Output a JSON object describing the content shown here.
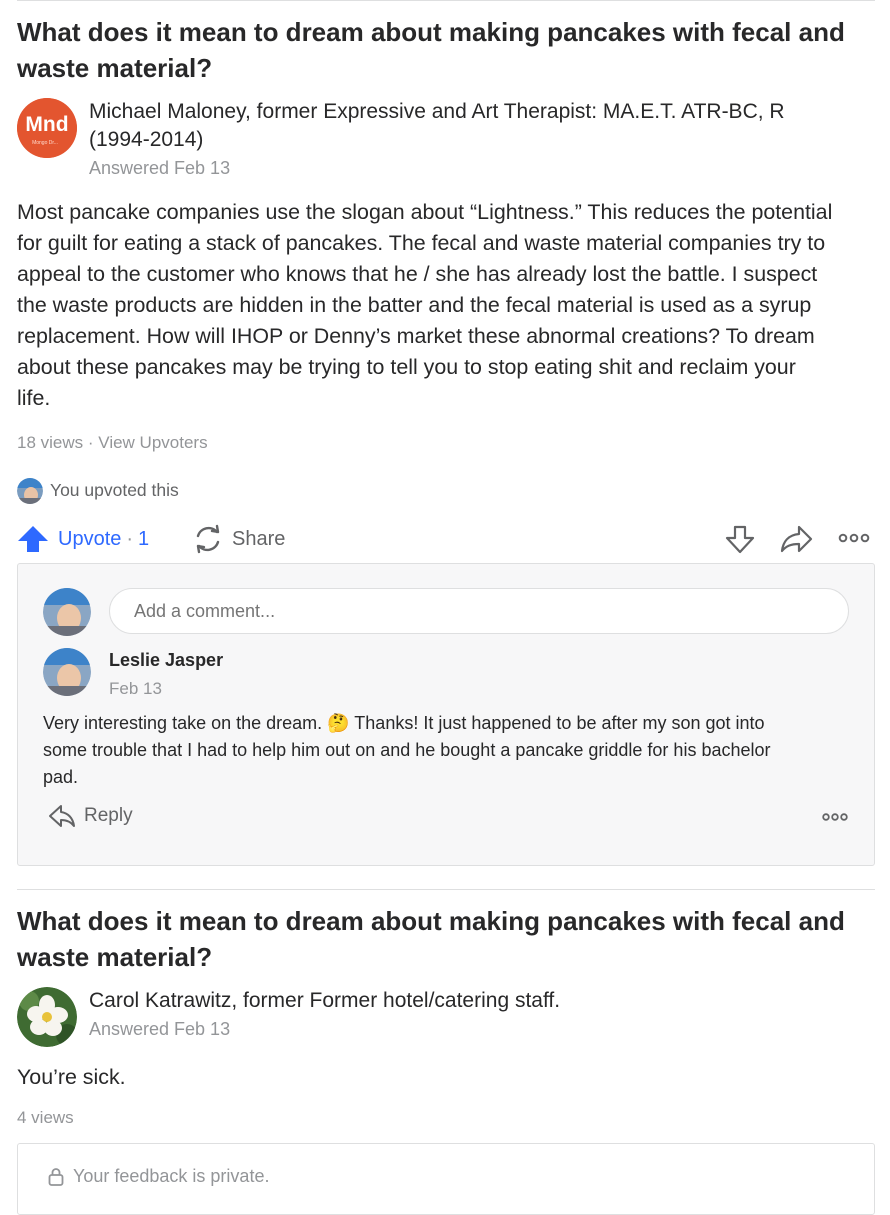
{
  "answers": [
    {
      "question": "What does it mean to dream about making pancakes with fecal and waste material?",
      "author": {
        "avatar_text": "Mnd",
        "avatar_subtext": "Mongo Dr...",
        "name_line1": "Michael Maloney, former Expressive and Art Therapist: MA.E.T. ATR-BC, R",
        "name_line2": "(1994-2014)",
        "answered": "Answered Feb 13"
      },
      "body": [
        "Most pancake companies use the slogan about “Lightness.” This reduces the potential",
        "for guilt for eating a stack of pancakes. The fecal and waste material companies try to",
        "appeal to the customer who knows that he / she has already lost the battle. I suspect",
        "the waste products are hidden in the batter and the fecal material is used as a syrup",
        "replacement. How will IHOP or Denny’s market these abnormal creations? To dream",
        "about these pancakes may be trying to tell you to stop eating shit and reclaim your",
        "life."
      ],
      "views": "18 views",
      "separator": "·",
      "view_upvoters": "View Upvoters",
      "upvoted_text": "You upvoted this",
      "actions": {
        "upvote_label": "Upvote",
        "upvote_sep": "·",
        "upvote_count": "1",
        "share_label": "Share"
      },
      "comments": {
        "placeholder": "Add a comment...",
        "items": [
          {
            "name": "Leslie Jasper",
            "date": "Feb 13",
            "text_before_emoji": "Very interesting take on the dream.",
            "emoji": "🤔",
            "text_after_emoji": "Thanks! It just happened to be after my son got into",
            "line2": "some trouble that I had to help him out on and he bought a pancake griddle for his bachelor",
            "line3": "pad.",
            "reply_label": "Reply"
          }
        ]
      }
    },
    {
      "question": "What does it mean to dream about making pancakes with fecal and waste material?",
      "author": {
        "name_line1": "Carol Katrawitz, former Former hotel/catering staff.",
        "answered": "Answered Feb 13"
      },
      "body": [
        "You’re sick."
      ],
      "views": "4 views",
      "feedback": "Your feedback is private."
    }
  ],
  "colors": {
    "upvote_blue": "#2e69ff",
    "meta_gray": "#939598",
    "text": "#282829",
    "avatar_orange": "#e3552f"
  },
  "icons": [
    "upvote-arrow-icon",
    "share-icon",
    "downvote-icon",
    "reshare-icon",
    "more-icon",
    "reply-icon",
    "lock-icon"
  ]
}
